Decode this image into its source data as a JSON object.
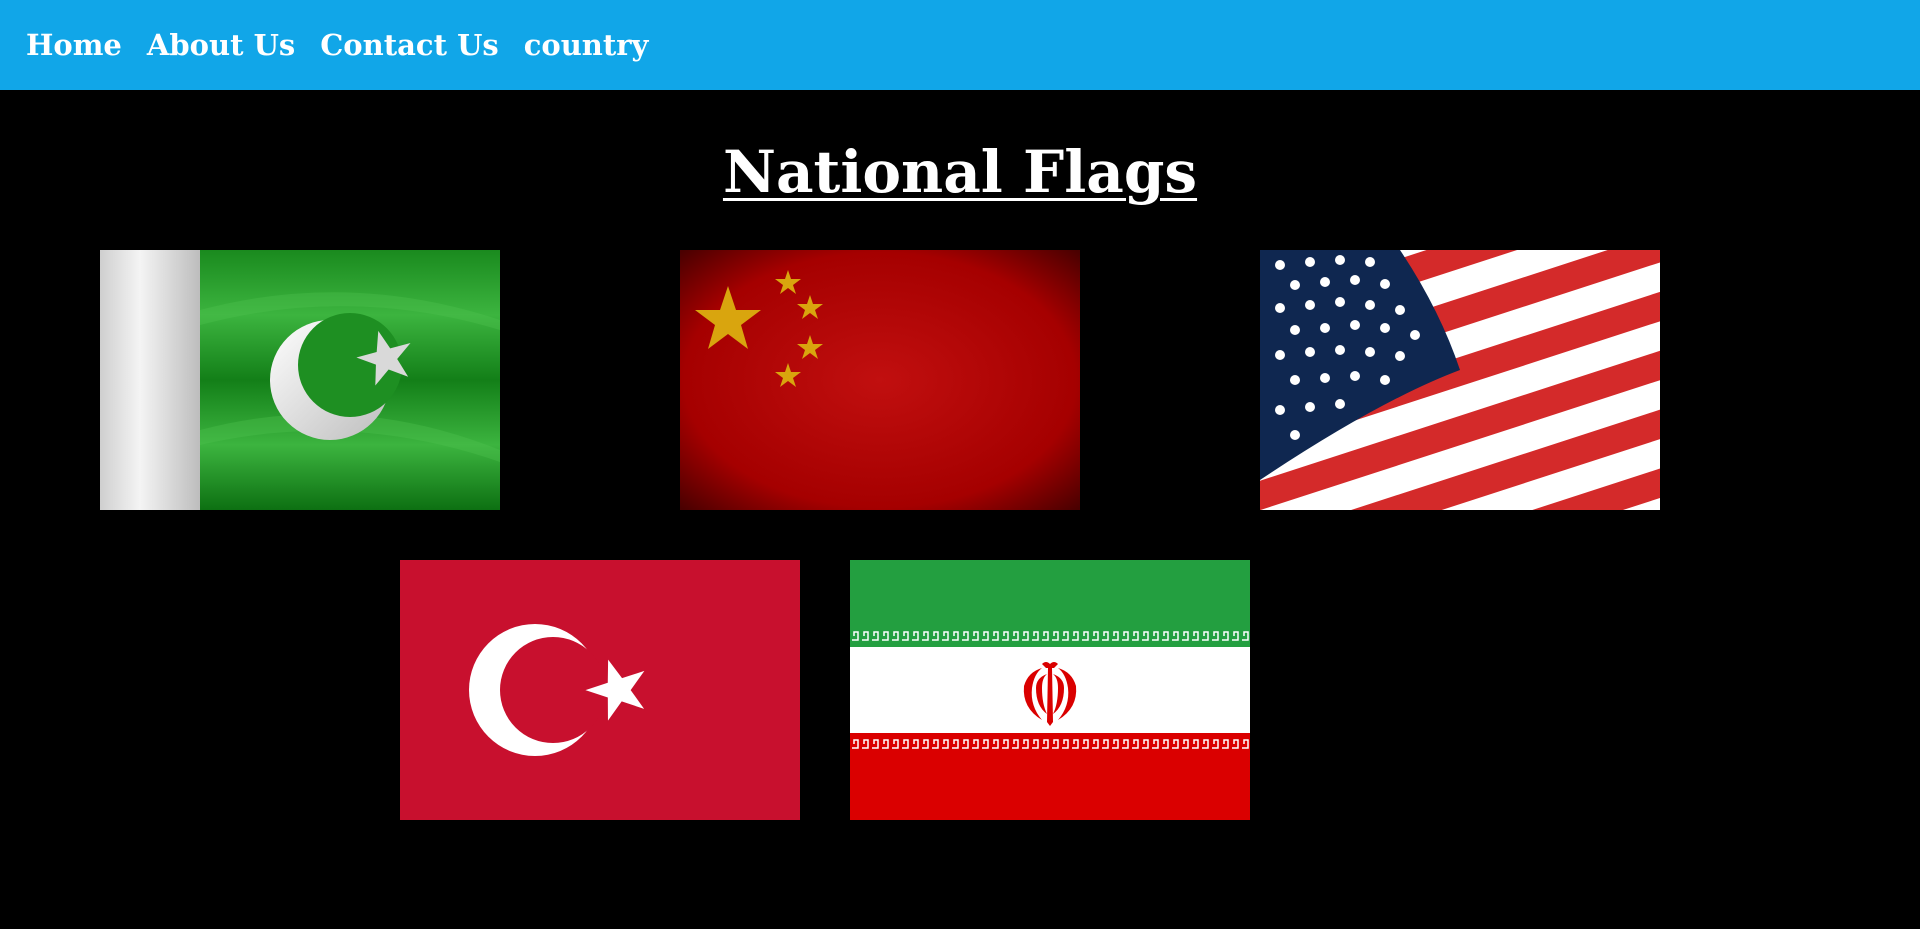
{
  "nav": {
    "items": [
      {
        "label": "Home"
      },
      {
        "label": "About Us"
      },
      {
        "label": "Contact Us"
      },
      {
        "label": "country"
      }
    ]
  },
  "main": {
    "title": "National Flags",
    "flags": [
      {
        "name": "pakistan-flag"
      },
      {
        "name": "china-flag"
      },
      {
        "name": "usa-flag"
      },
      {
        "name": "turkey-flag"
      },
      {
        "name": "iran-flag"
      }
    ]
  },
  "colors": {
    "navbar": "#11a6e8",
    "background": "#000000",
    "text": "#ffffff"
  }
}
